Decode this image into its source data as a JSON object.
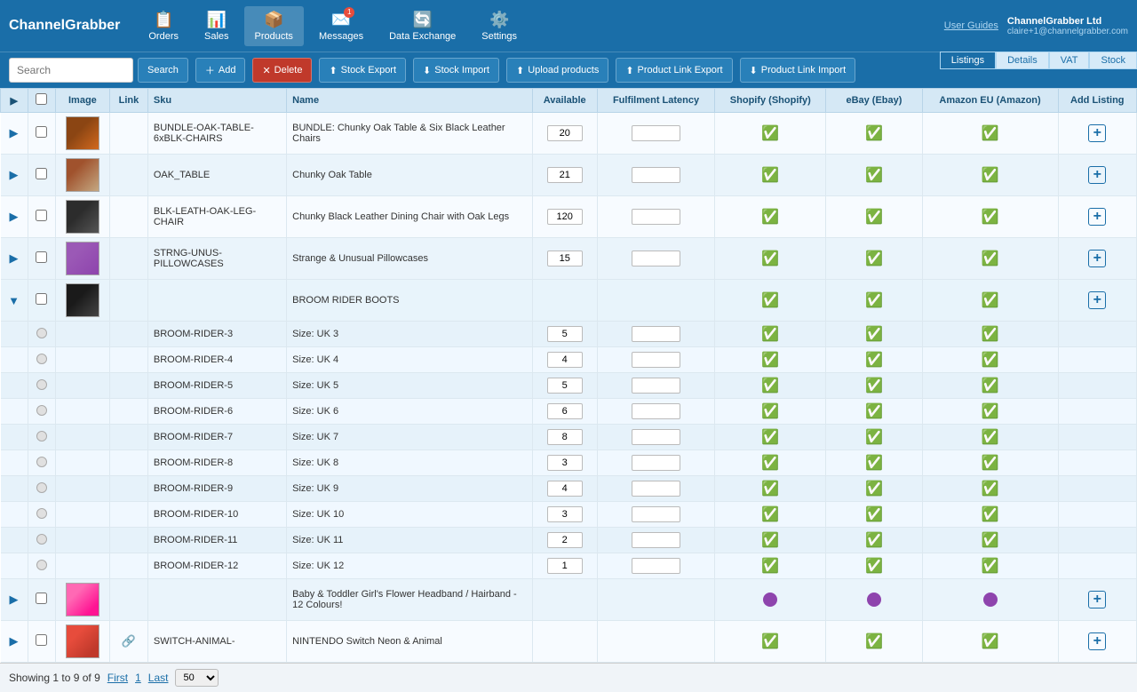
{
  "app": {
    "logo": "ChannelGrabber",
    "user_guide": "User Guides",
    "company": "ChannelGrabber Ltd",
    "email": "claire+1@channelgrabber.com"
  },
  "nav": {
    "items": [
      {
        "label": "Orders",
        "icon": "📋",
        "active": false
      },
      {
        "label": "Sales",
        "icon": "📊",
        "active": false
      },
      {
        "label": "Products",
        "icon": "📦",
        "active": true
      },
      {
        "label": "Messages",
        "icon": "✉️",
        "active": false,
        "badge": "1"
      },
      {
        "label": "Data Exchange",
        "icon": "🔄",
        "active": false
      },
      {
        "label": "Settings",
        "icon": "⚙️",
        "active": false
      }
    ]
  },
  "toolbar": {
    "search_placeholder": "Search",
    "search_btn": "Search",
    "add_btn": "Add",
    "delete_btn": "Delete",
    "stock_export_btn": "Stock Export",
    "stock_import_btn": "Stock Import",
    "upload_products_btn": "Upload products",
    "product_link_export_btn": "Product Link Export",
    "product_link_import_btn": "Product Link Import"
  },
  "tabs": {
    "right": [
      "Listings",
      "Details",
      "VAT",
      "Stock"
    ],
    "active": "Listings"
  },
  "table": {
    "headers": [
      "",
      "",
      "Image",
      "Link",
      "Sku",
      "Name",
      "Available",
      "Fulfilment Latency",
      "Shopify (Shopify)",
      "eBay (Ebay)",
      "Amazon EU (Amazon)",
      "Add Listing"
    ],
    "rows": [
      {
        "type": "parent",
        "expand": false,
        "checked": false,
        "sku": "BUNDLE-OAK-TABLE-6xBLK-CHAIRS",
        "name": "BUNDLE: Chunky Oak Table & Six Black Leather Chairs",
        "available": "20",
        "latency": "",
        "shopify": "check",
        "ebay": "check",
        "amazon": "check",
        "add_listing": true,
        "img_type": "table_chairs",
        "has_link": false
      },
      {
        "type": "parent",
        "expand": false,
        "checked": false,
        "sku": "OAK_TABLE",
        "name": "Chunky Oak Table",
        "available": "21",
        "latency": "",
        "shopify": "check",
        "ebay": "check",
        "amazon": "check",
        "add_listing": true,
        "img_type": "table",
        "has_link": false
      },
      {
        "type": "parent",
        "expand": false,
        "checked": false,
        "sku": "BLK-LEATH-OAK-LEG-CHAIR",
        "name": "Chunky Black Leather Dining Chair with Oak Legs",
        "available": "120",
        "latency": "",
        "shopify": "check",
        "ebay": "check",
        "amazon": "check",
        "add_listing": true,
        "img_type": "chair",
        "has_link": false
      },
      {
        "type": "parent",
        "expand": false,
        "checked": false,
        "sku": "STRNG-UNUS-PILLOWCASES",
        "name": "Strange & Unusual Pillowcases",
        "available": "15",
        "latency": "",
        "shopify": "check",
        "ebay": "check",
        "amazon": "check",
        "add_listing": true,
        "img_type": "pillow",
        "has_link": false
      },
      {
        "type": "parent_expanded",
        "expand": true,
        "checked": false,
        "sku": "",
        "name": "BROOM RIDER BOOTS",
        "available": "",
        "latency": "",
        "shopify": "check",
        "ebay": "check",
        "amazon": "check",
        "add_listing": true,
        "img_type": "boots",
        "has_link": false
      },
      {
        "type": "child",
        "sku": "BROOM-RIDER-3",
        "name": "Size: UK 3",
        "available": "5",
        "latency": "",
        "shopify": "check",
        "ebay": "check",
        "amazon": "check",
        "add_listing": false
      },
      {
        "type": "child",
        "sku": "BROOM-RIDER-4",
        "name": "Size: UK 4",
        "available": "4",
        "latency": "",
        "shopify": "check",
        "ebay": "check",
        "amazon": "check",
        "add_listing": false
      },
      {
        "type": "child",
        "sku": "BROOM-RIDER-5",
        "name": "Size: UK 5",
        "available": "5",
        "latency": "",
        "shopify": "check",
        "ebay": "check",
        "amazon": "check",
        "add_listing": false
      },
      {
        "type": "child",
        "sku": "BROOM-RIDER-6",
        "name": "Size: UK 6",
        "available": "6",
        "latency": "",
        "shopify": "check",
        "ebay": "check",
        "amazon": "check",
        "add_listing": false
      },
      {
        "type": "child",
        "sku": "BROOM-RIDER-7",
        "name": "Size: UK 7",
        "available": "8",
        "latency": "",
        "shopify": "check",
        "ebay": "check",
        "amazon": "check",
        "add_listing": false
      },
      {
        "type": "child",
        "sku": "BROOM-RIDER-8",
        "name": "Size: UK 8",
        "available": "3",
        "latency": "",
        "shopify": "check",
        "ebay": "check",
        "amazon": "check",
        "add_listing": false
      },
      {
        "type": "child",
        "sku": "BROOM-RIDER-9",
        "name": "Size: UK 9",
        "available": "4",
        "latency": "",
        "shopify": "check",
        "ebay": "check",
        "amazon": "check",
        "add_listing": false
      },
      {
        "type": "child",
        "sku": "BROOM-RIDER-10",
        "name": "Size: UK 10",
        "available": "3",
        "latency": "",
        "shopify": "check",
        "ebay": "check",
        "amazon": "check",
        "add_listing": false
      },
      {
        "type": "child",
        "sku": "BROOM-RIDER-11",
        "name": "Size: UK 11",
        "available": "2",
        "latency": "",
        "shopify": "check",
        "ebay": "check",
        "amazon": "check",
        "add_listing": false
      },
      {
        "type": "child",
        "sku": "BROOM-RIDER-12",
        "name": "Size: UK 12",
        "available": "1",
        "latency": "",
        "shopify": "check",
        "ebay": "check",
        "amazon": "check",
        "add_listing": false
      },
      {
        "type": "parent",
        "expand": false,
        "checked": false,
        "sku": "",
        "name": "Baby & Toddler Girl's Flower Headband / Hairband - 12 Colours!",
        "available": "",
        "latency": "",
        "shopify": "purple",
        "ebay": "purple",
        "amazon": "purple",
        "add_listing": true,
        "img_type": "headband",
        "has_link": false
      },
      {
        "type": "parent",
        "expand": false,
        "checked": false,
        "sku": "SWITCH-ANIMAL-",
        "name": "NINTENDO Switch Neon & Animal",
        "available": "",
        "latency": "",
        "shopify": "check",
        "ebay": "check",
        "amazon": "check",
        "add_listing": true,
        "img_type": "nintendo",
        "has_link": true
      }
    ]
  },
  "pagination": {
    "showing_text": "Showing 1 to 9 of 9",
    "first": "First",
    "page": "1",
    "last": "Last",
    "per_page": "50"
  }
}
